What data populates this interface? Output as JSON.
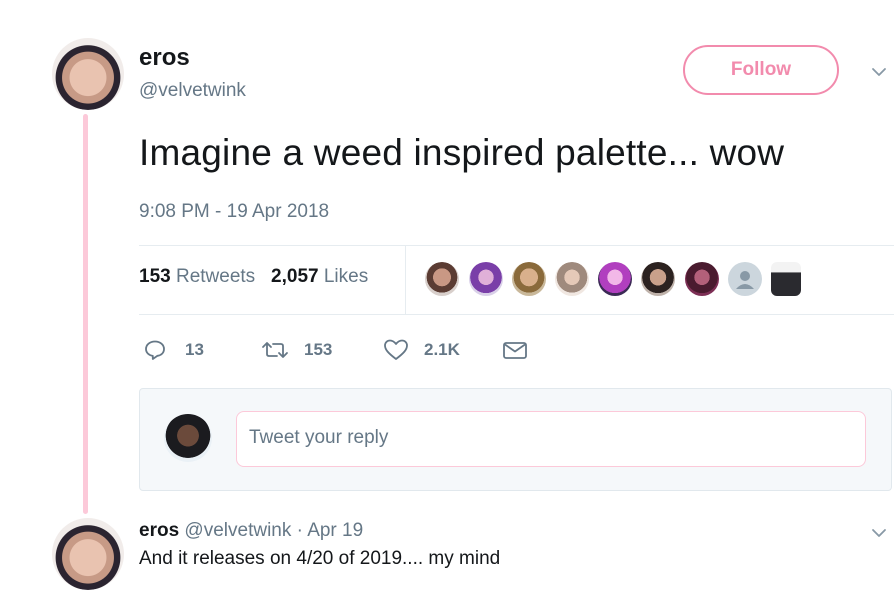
{
  "tweet": {
    "display_name": "eros",
    "handle": "@velvetwink",
    "follow_label": "Follow",
    "text": "Imagine a weed inspired palette... wow",
    "timestamp": "9:08 PM - 19 Apr 2018"
  },
  "stats": {
    "retweets_count": "153",
    "retweets_label": "Retweets",
    "likes_count": "2,057",
    "likes_label": "Likes"
  },
  "likers": [
    "liker-avatar-1",
    "liker-avatar-2",
    "liker-avatar-3",
    "liker-avatar-4",
    "liker-avatar-5",
    "liker-avatar-6",
    "liker-avatar-7",
    "liker-avatar-8",
    "liker-avatar-9"
  ],
  "actions": {
    "reply_count": "13",
    "retweet_count": "153",
    "like_count": "2.1K"
  },
  "reply": {
    "placeholder": "Tweet your reply"
  },
  "next_tweet": {
    "display_name": "eros",
    "meta": "@velvetwink · Apr 19",
    "text": "And it releases on 4/20 of 2019.... my mind"
  },
  "colors": {
    "accent_pink": "#f28bad",
    "thread_line": "#fcc9d9",
    "muted_text": "#657786"
  },
  "icons": [
    "chevron-down-icon",
    "reply-icon",
    "retweet-icon",
    "heart-icon",
    "mail-icon"
  ]
}
